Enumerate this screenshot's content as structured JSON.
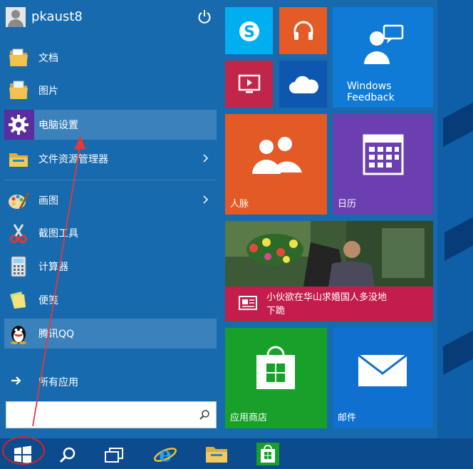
{
  "user": {
    "name": "pkaust8"
  },
  "menu_items": [
    {
      "label": "文档",
      "icon": "documents-folder-icon"
    },
    {
      "label": "图片",
      "icon": "pictures-folder-icon"
    },
    {
      "label": "电脑设置",
      "icon": "gear-icon"
    },
    {
      "label": "文件资源管理器",
      "icon": "file-explorer-icon"
    },
    {
      "label": "画图",
      "icon": "paint-icon"
    },
    {
      "label": "截图工具",
      "icon": "snipping-tool-icon"
    },
    {
      "label": "计算器",
      "icon": "calculator-icon"
    },
    {
      "label": "便笺",
      "icon": "sticky-notes-icon"
    },
    {
      "label": "腾讯QQ",
      "icon": "qq-penguin-icon"
    }
  ],
  "all_apps": {
    "label": "所有应用"
  },
  "search": {
    "value": "",
    "placeholder": ""
  },
  "tiles": {
    "skype": {
      "icon": "skype-icon",
      "color": "#00aff0"
    },
    "music": {
      "icon": "headphones-icon",
      "color": "#e55b26"
    },
    "video": {
      "icon": "video-icon",
      "color": "#c1254a"
    },
    "onedrive": {
      "icon": "cloud-icon",
      "color": "#0e57b0"
    },
    "feedback": {
      "label": "Windows\nFeedback",
      "line1": "Windows",
      "line2": "Feedback",
      "icon": "feedback-person-icon",
      "color": "#0f7bd6"
    },
    "people": {
      "label": "人脉",
      "icon": "people-icon",
      "color": "#e45a27"
    },
    "calendar": {
      "label": "日历",
      "icon": "calendar-icon",
      "color": "#6b3fb0"
    },
    "news": {
      "headline_line1": "小伙欲在华山求婚国人多没地",
      "headline_line2": "下跪",
      "icon": "news-icon",
      "color": "#c41d4b"
    },
    "store": {
      "label": "应用商店",
      "icon": "store-bag-icon",
      "color": "#17a02a"
    },
    "mail": {
      "label": "邮件",
      "icon": "mail-envelope-icon",
      "color": "#0f70cf"
    }
  },
  "taskbar": {
    "buttons": [
      "windows-start-icon",
      "search-icon",
      "task-view-icon",
      "internet-explorer-icon",
      "file-explorer-icon",
      "store-icon"
    ]
  }
}
